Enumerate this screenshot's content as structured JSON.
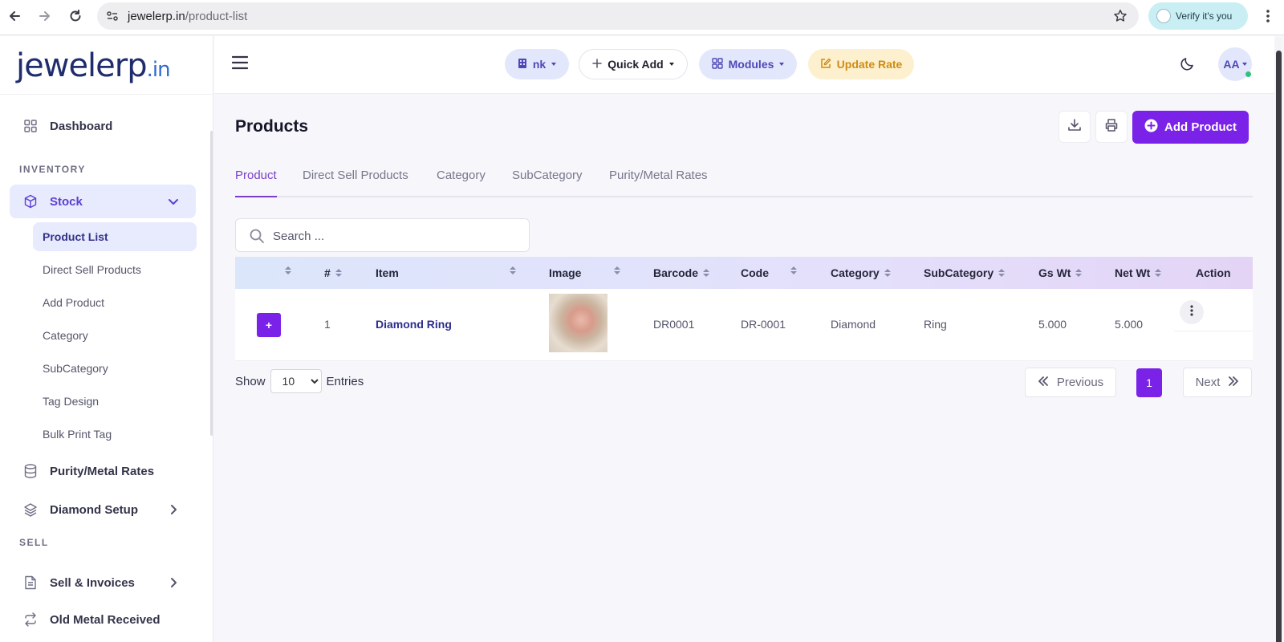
{
  "browser": {
    "url_domain": "jewelerp.in",
    "url_path": "/product-list",
    "verify_label": "Verify it's you"
  },
  "sidebar": {
    "logo_main": "jewelerp",
    "logo_suffix": ".in",
    "dashboard": "Dashboard",
    "section_inventory": "INVENTORY",
    "stock": "Stock",
    "sub_items": [
      "Product List",
      "Direct Sell Products",
      "Add Product",
      "Category",
      "SubCategory",
      "Tag Design",
      "Bulk Print Tag"
    ],
    "purity": "Purity/Metal Rates",
    "diamond_setup": "Diamond Setup",
    "section_sell": "SELL",
    "sell_invoices": "Sell & Invoices",
    "old_metal": "Old Metal Received"
  },
  "header": {
    "branch": "nk",
    "quick_add": "Quick Add",
    "modules": "Modules",
    "update_rate": "Update Rate",
    "avatar_initials": "AA"
  },
  "main": {
    "title": "Products",
    "add_product": "Add Product",
    "tabs": [
      "Product",
      "Direct Sell Products",
      "Category",
      "SubCategory",
      "Purity/Metal Rates"
    ],
    "search_placeholder": "Search ...",
    "columns": [
      "#",
      "Item",
      "Image",
      "Barcode",
      "Code",
      "Category",
      "SubCategory",
      "Gs Wt",
      "Net Wt",
      "Action"
    ],
    "rows": [
      {
        "index": "1",
        "item": "Diamond Ring",
        "barcode": "DR0001",
        "code": "DR-0001",
        "category": "Diamond",
        "subcategory": "Ring",
        "gs_wt": "5.000",
        "net_wt": "5.000"
      }
    ],
    "show_label": "Show",
    "entries_value": "10",
    "entries_label": "Entries",
    "previous": "Previous",
    "current_page": "1",
    "next": "Next"
  },
  "colors": {
    "accent": "#7a22e8",
    "active_tab": "#7a3fc9",
    "update_rate_bg": "#fdf0cf"
  }
}
